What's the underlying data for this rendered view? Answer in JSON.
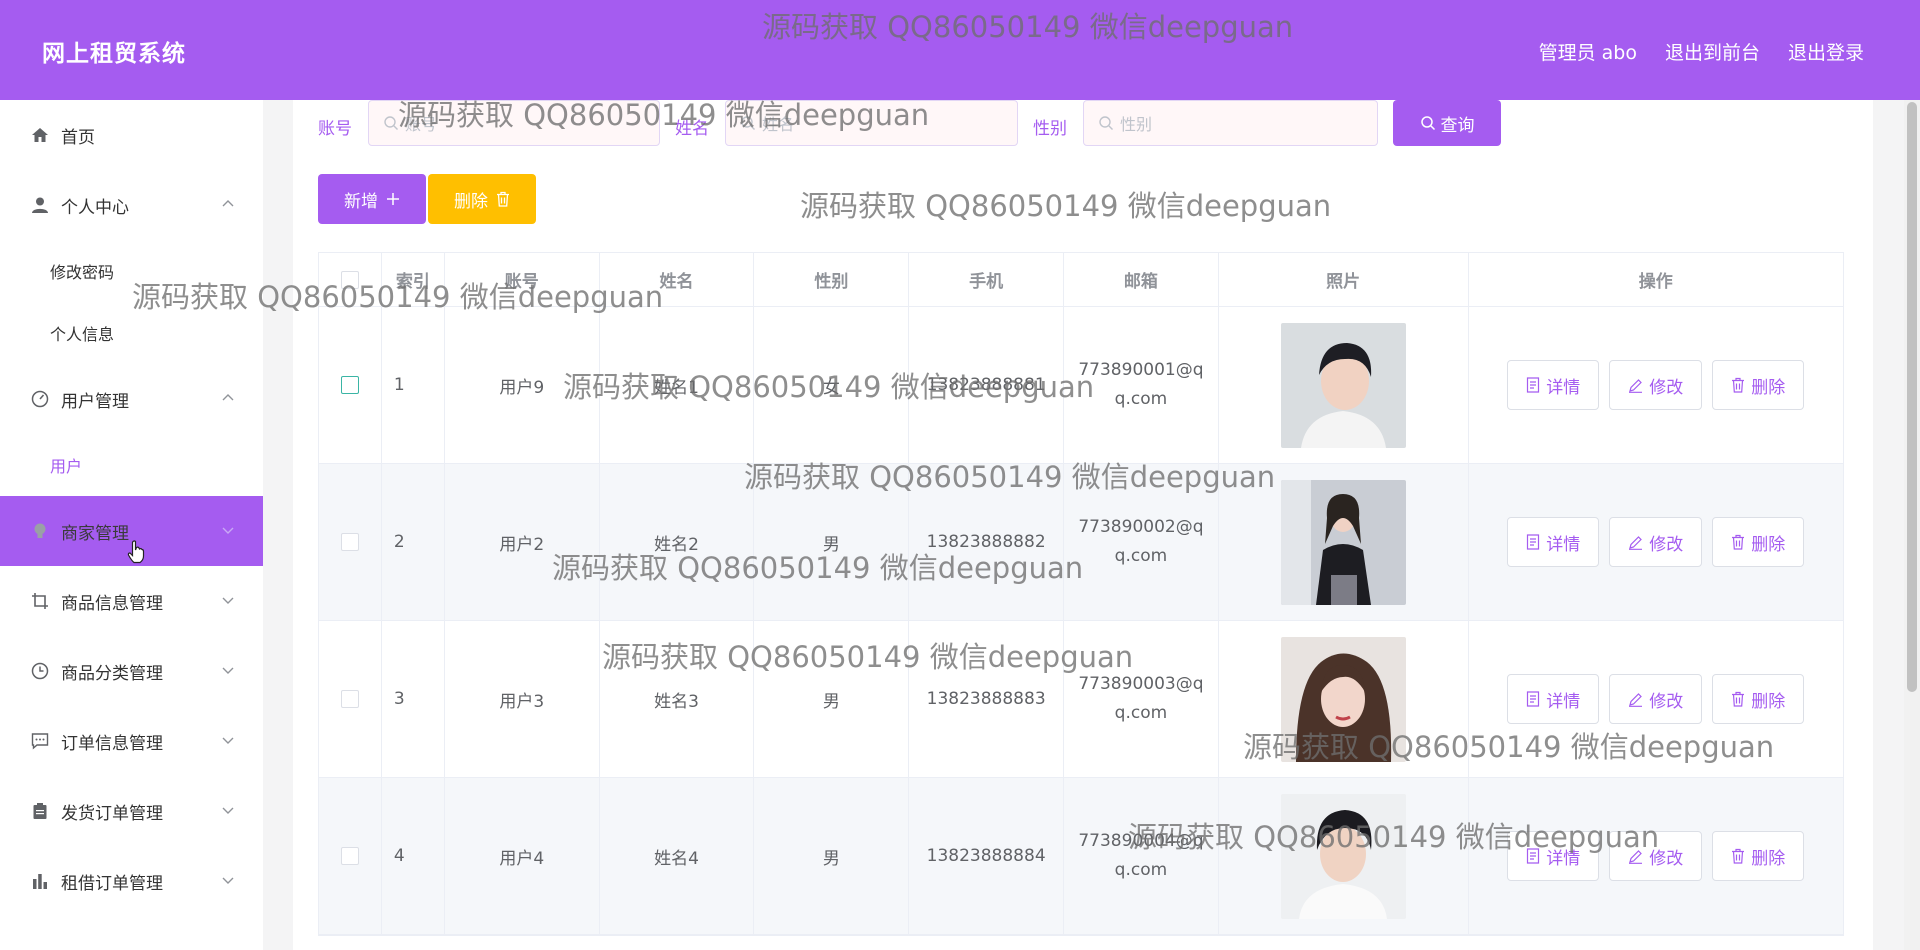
{
  "header": {
    "brand": "网上租贸系统",
    "links": [
      "管理员 abo",
      "退出到前台",
      "退出登录"
    ]
  },
  "sidebar": {
    "items": [
      {
        "label": "首页",
        "icon": "home-icon",
        "expandable": false
      },
      {
        "label": "个人中心",
        "icon": "user-icon",
        "expandable": true,
        "expanded": true,
        "children": [
          "修改密码",
          "个人信息"
        ]
      },
      {
        "label": "用户管理",
        "icon": "dashboard-icon",
        "expandable": true,
        "expanded": true,
        "children": [
          "用户"
        ],
        "selected_child": "用户"
      },
      {
        "label": "商家管理",
        "icon": "lightbulb-icon",
        "expandable": true,
        "active": true
      },
      {
        "label": "商品信息管理",
        "icon": "crop-icon",
        "expandable": true
      },
      {
        "label": "商品分类管理",
        "icon": "clock-icon",
        "expandable": true
      },
      {
        "label": "订单信息管理",
        "icon": "chat-icon",
        "expandable": true
      },
      {
        "label": "发货订单管理",
        "icon": "clipboard-icon",
        "expandable": true
      },
      {
        "label": "租借订单管理",
        "icon": "bar-chart-icon",
        "expandable": true
      }
    ]
  },
  "search": {
    "fields": [
      {
        "label": "账号",
        "placeholder": "账号"
      },
      {
        "label": "姓名",
        "placeholder": "姓名"
      },
      {
        "label": "性别",
        "placeholder": "性别"
      }
    ],
    "query_label": "查询"
  },
  "actions": {
    "add_label": "新增",
    "delete_label": "删除"
  },
  "table": {
    "columns": [
      "索引",
      "账号",
      "姓名",
      "性别",
      "手机",
      "邮箱",
      "照片",
      "操作"
    ],
    "rows": [
      {
        "index": "1",
        "account": "用户9",
        "name": "姓名1",
        "gender": "女",
        "phone": "13823888881",
        "email_1": "773890001@q",
        "email_2": "q.com",
        "photo": "photo-young-man-white-sweater"
      },
      {
        "index": "2",
        "account": "用户2",
        "name": "姓名2",
        "gender": "男",
        "phone": "13823888882",
        "email_1": "773890002@q",
        "email_2": "q.com",
        "photo": "photo-girl-school-uniform"
      },
      {
        "index": "3",
        "account": "用户3",
        "name": "姓名3",
        "gender": "男",
        "phone": "13823888883",
        "email_1": "773890003@q",
        "email_2": "q.com",
        "photo": "photo-woman-wavy-hair"
      },
      {
        "index": "4",
        "account": "用户4",
        "name": "姓名4",
        "gender": "男",
        "phone": "13823888884",
        "email_1": "773890004@q",
        "email_2": "q.com",
        "photo": "photo-young-man-white-shirt"
      }
    ],
    "row_actions": [
      "详情",
      "修改",
      "删除"
    ]
  },
  "watermark": "源码获取 QQ86050149 微信deepguan",
  "colors": {
    "accent": "#a55cf0",
    "warning": "#ffbf00",
    "header_text": "#ffffff"
  }
}
